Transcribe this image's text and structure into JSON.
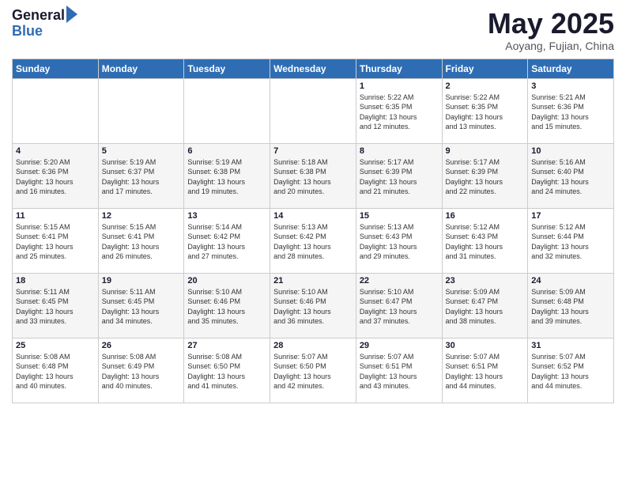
{
  "header": {
    "logo_general": "General",
    "logo_blue": "Blue",
    "month": "May 2025",
    "location": "Aoyang, Fujian, China"
  },
  "weekdays": [
    "Sunday",
    "Monday",
    "Tuesday",
    "Wednesday",
    "Thursday",
    "Friday",
    "Saturday"
  ],
  "rows": [
    [
      {
        "day": "",
        "info": ""
      },
      {
        "day": "",
        "info": ""
      },
      {
        "day": "",
        "info": ""
      },
      {
        "day": "",
        "info": ""
      },
      {
        "day": "1",
        "info": "Sunrise: 5:22 AM\nSunset: 6:35 PM\nDaylight: 13 hours\nand 12 minutes."
      },
      {
        "day": "2",
        "info": "Sunrise: 5:22 AM\nSunset: 6:35 PM\nDaylight: 13 hours\nand 13 minutes."
      },
      {
        "day": "3",
        "info": "Sunrise: 5:21 AM\nSunset: 6:36 PM\nDaylight: 13 hours\nand 15 minutes."
      }
    ],
    [
      {
        "day": "4",
        "info": "Sunrise: 5:20 AM\nSunset: 6:36 PM\nDaylight: 13 hours\nand 16 minutes."
      },
      {
        "day": "5",
        "info": "Sunrise: 5:19 AM\nSunset: 6:37 PM\nDaylight: 13 hours\nand 17 minutes."
      },
      {
        "day": "6",
        "info": "Sunrise: 5:19 AM\nSunset: 6:38 PM\nDaylight: 13 hours\nand 19 minutes."
      },
      {
        "day": "7",
        "info": "Sunrise: 5:18 AM\nSunset: 6:38 PM\nDaylight: 13 hours\nand 20 minutes."
      },
      {
        "day": "8",
        "info": "Sunrise: 5:17 AM\nSunset: 6:39 PM\nDaylight: 13 hours\nand 21 minutes."
      },
      {
        "day": "9",
        "info": "Sunrise: 5:17 AM\nSunset: 6:39 PM\nDaylight: 13 hours\nand 22 minutes."
      },
      {
        "day": "10",
        "info": "Sunrise: 5:16 AM\nSunset: 6:40 PM\nDaylight: 13 hours\nand 24 minutes."
      }
    ],
    [
      {
        "day": "11",
        "info": "Sunrise: 5:15 AM\nSunset: 6:41 PM\nDaylight: 13 hours\nand 25 minutes."
      },
      {
        "day": "12",
        "info": "Sunrise: 5:15 AM\nSunset: 6:41 PM\nDaylight: 13 hours\nand 26 minutes."
      },
      {
        "day": "13",
        "info": "Sunrise: 5:14 AM\nSunset: 6:42 PM\nDaylight: 13 hours\nand 27 minutes."
      },
      {
        "day": "14",
        "info": "Sunrise: 5:13 AM\nSunset: 6:42 PM\nDaylight: 13 hours\nand 28 minutes."
      },
      {
        "day": "15",
        "info": "Sunrise: 5:13 AM\nSunset: 6:43 PM\nDaylight: 13 hours\nand 29 minutes."
      },
      {
        "day": "16",
        "info": "Sunrise: 5:12 AM\nSunset: 6:43 PM\nDaylight: 13 hours\nand 31 minutes."
      },
      {
        "day": "17",
        "info": "Sunrise: 5:12 AM\nSunset: 6:44 PM\nDaylight: 13 hours\nand 32 minutes."
      }
    ],
    [
      {
        "day": "18",
        "info": "Sunrise: 5:11 AM\nSunset: 6:45 PM\nDaylight: 13 hours\nand 33 minutes."
      },
      {
        "day": "19",
        "info": "Sunrise: 5:11 AM\nSunset: 6:45 PM\nDaylight: 13 hours\nand 34 minutes."
      },
      {
        "day": "20",
        "info": "Sunrise: 5:10 AM\nSunset: 6:46 PM\nDaylight: 13 hours\nand 35 minutes."
      },
      {
        "day": "21",
        "info": "Sunrise: 5:10 AM\nSunset: 6:46 PM\nDaylight: 13 hours\nand 36 minutes."
      },
      {
        "day": "22",
        "info": "Sunrise: 5:10 AM\nSunset: 6:47 PM\nDaylight: 13 hours\nand 37 minutes."
      },
      {
        "day": "23",
        "info": "Sunrise: 5:09 AM\nSunset: 6:47 PM\nDaylight: 13 hours\nand 38 minutes."
      },
      {
        "day": "24",
        "info": "Sunrise: 5:09 AM\nSunset: 6:48 PM\nDaylight: 13 hours\nand 39 minutes."
      }
    ],
    [
      {
        "day": "25",
        "info": "Sunrise: 5:08 AM\nSunset: 6:48 PM\nDaylight: 13 hours\nand 40 minutes."
      },
      {
        "day": "26",
        "info": "Sunrise: 5:08 AM\nSunset: 6:49 PM\nDaylight: 13 hours\nand 40 minutes."
      },
      {
        "day": "27",
        "info": "Sunrise: 5:08 AM\nSunset: 6:50 PM\nDaylight: 13 hours\nand 41 minutes."
      },
      {
        "day": "28",
        "info": "Sunrise: 5:07 AM\nSunset: 6:50 PM\nDaylight: 13 hours\nand 42 minutes."
      },
      {
        "day": "29",
        "info": "Sunrise: 5:07 AM\nSunset: 6:51 PM\nDaylight: 13 hours\nand 43 minutes."
      },
      {
        "day": "30",
        "info": "Sunrise: 5:07 AM\nSunset: 6:51 PM\nDaylight: 13 hours\nand 44 minutes."
      },
      {
        "day": "31",
        "info": "Sunrise: 5:07 AM\nSunset: 6:52 PM\nDaylight: 13 hours\nand 44 minutes."
      }
    ]
  ]
}
